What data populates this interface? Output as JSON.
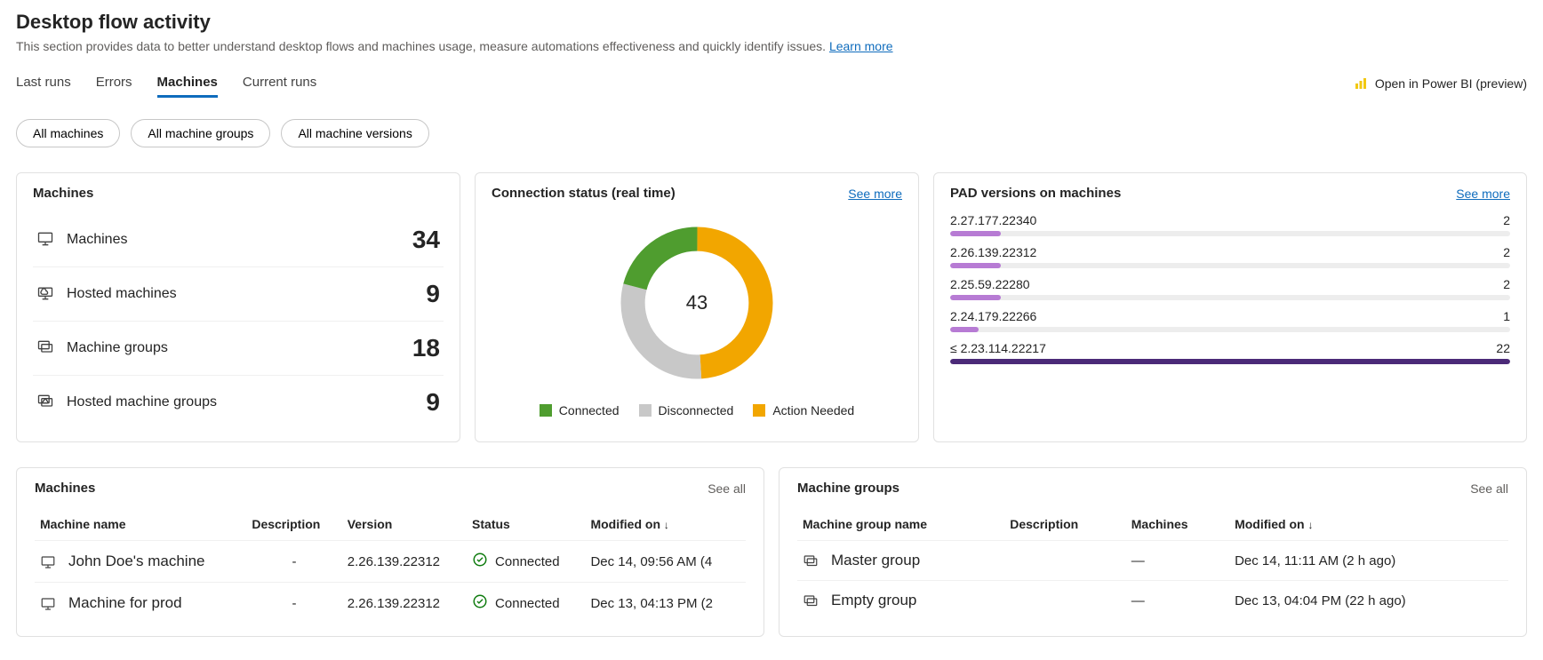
{
  "header": {
    "title": "Desktop flow activity",
    "subtitle": "This section provides data to better understand desktop flows and machines usage, measure automations effectiveness and quickly identify issues.",
    "learn_more": "Learn more",
    "open_bi": "Open in Power BI (preview)"
  },
  "tabs": {
    "last_runs": "Last runs",
    "errors": "Errors",
    "machines": "Machines",
    "current_runs": "Current runs"
  },
  "filters": {
    "all_machines": "All machines",
    "all_groups": "All machine groups",
    "all_versions": "All machine versions"
  },
  "machines_card": {
    "title": "Machines",
    "rows": [
      {
        "label": "Machines",
        "value": "34",
        "icon": "machine"
      },
      {
        "label": "Hosted machines",
        "value": "9",
        "icon": "hosted"
      },
      {
        "label": "Machine groups",
        "value": "18",
        "icon": "group"
      },
      {
        "label": "Hosted machine groups",
        "value": "9",
        "icon": "hosted-group"
      }
    ]
  },
  "connection_card": {
    "title": "Connection status (real time)",
    "see_more": "See more",
    "total": "43",
    "legend": {
      "connected": "Connected",
      "disconnected": "Disconnected",
      "action": "Action Needed"
    },
    "colors": {
      "connected": "#4f9d2f",
      "disconnected": "#c8c8c8",
      "action": "#f2a600"
    }
  },
  "pad_card": {
    "title": "PAD versions on machines",
    "see_more": "See more",
    "rows": [
      {
        "label": "2.27.177.22340",
        "value": "2",
        "pct": 9,
        "color": "#b77bd4"
      },
      {
        "label": "2.26.139.22312",
        "value": "2",
        "pct": 9,
        "color": "#b77bd4"
      },
      {
        "label": "2.25.59.22280",
        "value": "2",
        "pct": 9,
        "color": "#b77bd4"
      },
      {
        "label": "2.24.179.22266",
        "value": "1",
        "pct": 5,
        "color": "#b77bd4"
      },
      {
        "label": "≤ 2.23.114.22217",
        "value": "22",
        "pct": 100,
        "color": "#4b2a78"
      }
    ]
  },
  "machines_table": {
    "title": "Machines",
    "see_all": "See all",
    "headers": {
      "name": "Machine name",
      "desc": "Description",
      "version": "Version",
      "status": "Status",
      "modified": "Modified on"
    },
    "rows": [
      {
        "name": "John Doe's machine",
        "desc": "-",
        "version": "2.26.139.22312",
        "status": "Connected",
        "modified": "Dec 14, 09:56 AM (4"
      },
      {
        "name": "Machine for prod",
        "desc": "-",
        "version": "2.26.139.22312",
        "status": "Connected",
        "modified": "Dec 13, 04:13 PM (2"
      }
    ]
  },
  "groups_table": {
    "title": "Machine groups",
    "see_all": "See all",
    "headers": {
      "name": "Machine group name",
      "desc": "Description",
      "machines": "Machines",
      "modified": "Modified on"
    },
    "rows": [
      {
        "name": "Master group",
        "desc": "",
        "machines": "—",
        "modified": "Dec 14, 11:11 AM (2 h ago)"
      },
      {
        "name": "Empty group",
        "desc": "",
        "machines": "—",
        "modified": "Dec 13, 04:04 PM (22 h ago)"
      }
    ]
  },
  "chart_data": {
    "type": "pie",
    "title": "Connection status (real time)",
    "total": 43,
    "series": [
      {
        "name": "Connected",
        "value": 9,
        "color": "#4f9d2f"
      },
      {
        "name": "Disconnected",
        "value": 13,
        "color": "#c8c8c8"
      },
      {
        "name": "Action Needed",
        "value": 21,
        "color": "#f2a600"
      }
    ]
  }
}
